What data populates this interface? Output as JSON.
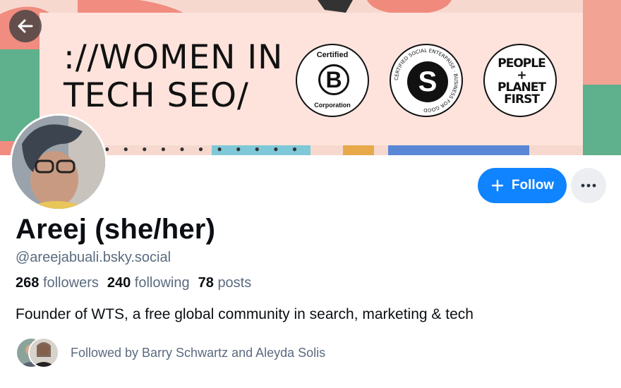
{
  "banner": {
    "wordmark_line1": "://WOMEN IN",
    "wordmark_line2": "TECH SEO/",
    "badge_b_top": "Certified",
    "badge_b_letter": "B",
    "badge_b_bottom": "Corporation",
    "badge_s_ring": "CERTIFIED SOCIAL ENTERPRISE · BUSINESS FOR GOOD",
    "badge_s_letter": "S",
    "badge_p_line1": "PEOPLE",
    "badge_p_line2": "+",
    "badge_p_line3": "PLANET",
    "badge_p_line4": "FIRST"
  },
  "nav": {
    "back_icon": "arrow-left-icon"
  },
  "profile": {
    "display_name": "Areej (she/her)",
    "handle": "@areejabuali.bsky.social",
    "followers_count": "268",
    "followers_label": "followers",
    "following_count": "240",
    "following_label": "following",
    "posts_count": "78",
    "posts_label": "posts",
    "bio": "Founder of WTS, a free global community in search, marketing & tech",
    "followed_by": "Followed by Barry Schwartz and Aleyda Solis"
  },
  "actions": {
    "follow_label": "Follow",
    "follow_icon": "plus-icon",
    "more_icon": "ellipsis-icon"
  },
  "colors": {
    "accent": "#1083fe",
    "muted_text": "#5b6b7f"
  }
}
